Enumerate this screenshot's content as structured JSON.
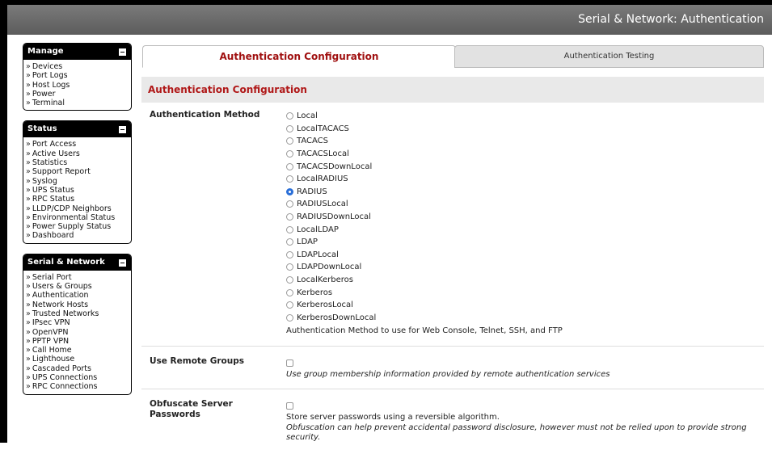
{
  "header": {
    "title": "Serial & Network: Authentication"
  },
  "sidebar": {
    "manage": {
      "title": "Manage",
      "items": [
        "Devices",
        "Port Logs",
        "Host Logs",
        "Power",
        "Terminal"
      ]
    },
    "status": {
      "title": "Status",
      "items": [
        "Port Access",
        "Active Users",
        "Statistics",
        "Support Report",
        "Syslog",
        "UPS Status",
        "RPC Status",
        "LLDP/CDP Neighbors",
        "Environmental Status",
        "Power Supply Status",
        "Dashboard"
      ]
    },
    "serial_network": {
      "title": "Serial & Network",
      "items": [
        "Serial Port",
        "Users & Groups",
        "Authentication",
        "Network Hosts",
        "Trusted Networks",
        "IPsec VPN",
        "OpenVPN",
        "PPTP VPN",
        "Call Home",
        "Lighthouse",
        "Cascaded Ports",
        "UPS Connections",
        "RPC Connections"
      ]
    }
  },
  "tabs": {
    "config": "Authentication Configuration",
    "testing": "Authentication Testing"
  },
  "section": {
    "title": "Authentication Configuration"
  },
  "auth_method": {
    "label": "Authentication Method",
    "options": [
      "Local",
      "LocalTACACS",
      "TACACS",
      "TACACSLocal",
      "TACACSDownLocal",
      "LocalRADIUS",
      "RADIUS",
      "RADIUSLocal",
      "RADIUSDownLocal",
      "LocalLDAP",
      "LDAP",
      "LDAPLocal",
      "LDAPDownLocal",
      "LocalKerberos",
      "Kerberos",
      "KerberosLocal",
      "KerberosDownLocal"
    ],
    "selected": "RADIUS",
    "help": "Authentication Method to use for Web Console, Telnet, SSH, and FTP"
  },
  "remote_groups": {
    "label": "Use Remote Groups",
    "help": "Use group membership information provided by remote authentication services"
  },
  "obfuscate": {
    "label_line1": "Obfuscate Server",
    "label_line2": "Passwords",
    "help1": "Store server passwords using a reversible algorithm.",
    "help2": "Obfuscation can help prevent accidental password disclosure, however must not be relied upon to provide strong security."
  },
  "colors": {
    "accent": "#b01818",
    "radio_checked": "#2a6fd8"
  }
}
